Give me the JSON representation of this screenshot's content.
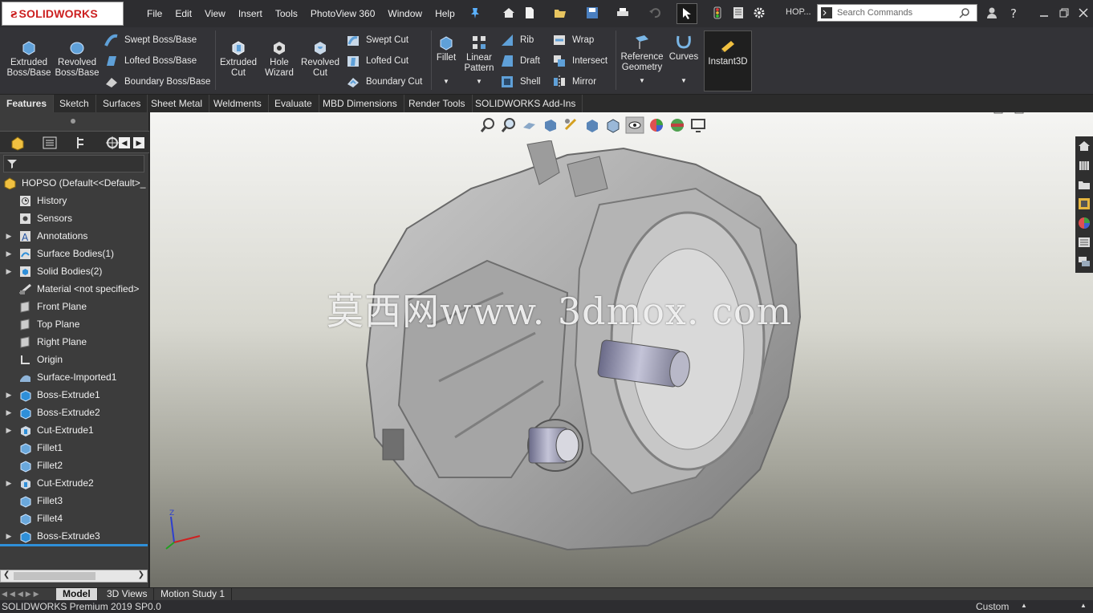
{
  "app": {
    "logo_text": "SOLIDWORKS",
    "doc_short": "HOP...",
    "status_text": "SOLIDWORKS Premium 2019 SP0.0",
    "units": "Custom"
  },
  "menu": [
    "File",
    "Edit",
    "View",
    "Insert",
    "Tools",
    "PhotoView 360",
    "Window",
    "Help"
  ],
  "search": {
    "placeholder": "Search Commands"
  },
  "ribbon": {
    "extruded_boss": "Extruded\nBoss/Base",
    "revolved_boss": "Revolved\nBoss/Base",
    "swept_boss": "Swept Boss/Base",
    "lofted_boss": "Lofted Boss/Base",
    "boundary_boss": "Boundary Boss/Base",
    "extruded_cut": "Extruded\nCut",
    "hole_wizard": "Hole\nWizard",
    "revolved_cut": "Revolved\nCut",
    "swept_cut": "Swept Cut",
    "lofted_cut": "Lofted Cut",
    "boundary_cut": "Boundary Cut",
    "fillet": "Fillet",
    "linear_pattern": "Linear\nPattern",
    "rib": "Rib",
    "draft": "Draft",
    "shell": "Shell",
    "wrap": "Wrap",
    "intersect": "Intersect",
    "mirror": "Mirror",
    "reference_geometry": "Reference\nGeometry",
    "curves": "Curves",
    "instant3d": "Instant3D"
  },
  "tabs": [
    "Features",
    "Sketch",
    "Surfaces",
    "Sheet Metal",
    "Weldments",
    "Evaluate",
    "MBD Dimensions",
    "Render Tools",
    "SOLIDWORKS Add-Ins"
  ],
  "tree": {
    "root": "HOPSO  (Default<<Default>_",
    "items": [
      {
        "label": "History",
        "expandable": false
      },
      {
        "label": "Sensors",
        "expandable": false
      },
      {
        "label": "Annotations",
        "expandable": true
      },
      {
        "label": "Surface Bodies(1)",
        "expandable": true
      },
      {
        "label": "Solid Bodies(2)",
        "expandable": true
      },
      {
        "label": "Material <not specified>",
        "expandable": false
      },
      {
        "label": "Front Plane",
        "expandable": false
      },
      {
        "label": "Top Plane",
        "expandable": false
      },
      {
        "label": "Right Plane",
        "expandable": false
      },
      {
        "label": "Origin",
        "expandable": false
      },
      {
        "label": "Surface-Imported1",
        "expandable": false
      },
      {
        "label": "Boss-Extrude1",
        "expandable": true
      },
      {
        "label": "Boss-Extrude2",
        "expandable": true
      },
      {
        "label": "Cut-Extrude1",
        "expandable": true
      },
      {
        "label": "Fillet1",
        "expandable": false
      },
      {
        "label": "Fillet2",
        "expandable": false
      },
      {
        "label": "Cut-Extrude2",
        "expandable": true
      },
      {
        "label": "Fillet3",
        "expandable": false
      },
      {
        "label": "Fillet4",
        "expandable": false
      },
      {
        "label": "Boss-Extrude3",
        "expandable": true
      }
    ]
  },
  "bottom_tabs": [
    "Model",
    "3D Views",
    "Motion Study 1"
  ],
  "watermark": "莫西网www. 3dmox. com",
  "triad": {
    "z": "Z"
  },
  "colors": {
    "accent": "#2f8fd8",
    "logo_red": "#cc1f1f"
  }
}
